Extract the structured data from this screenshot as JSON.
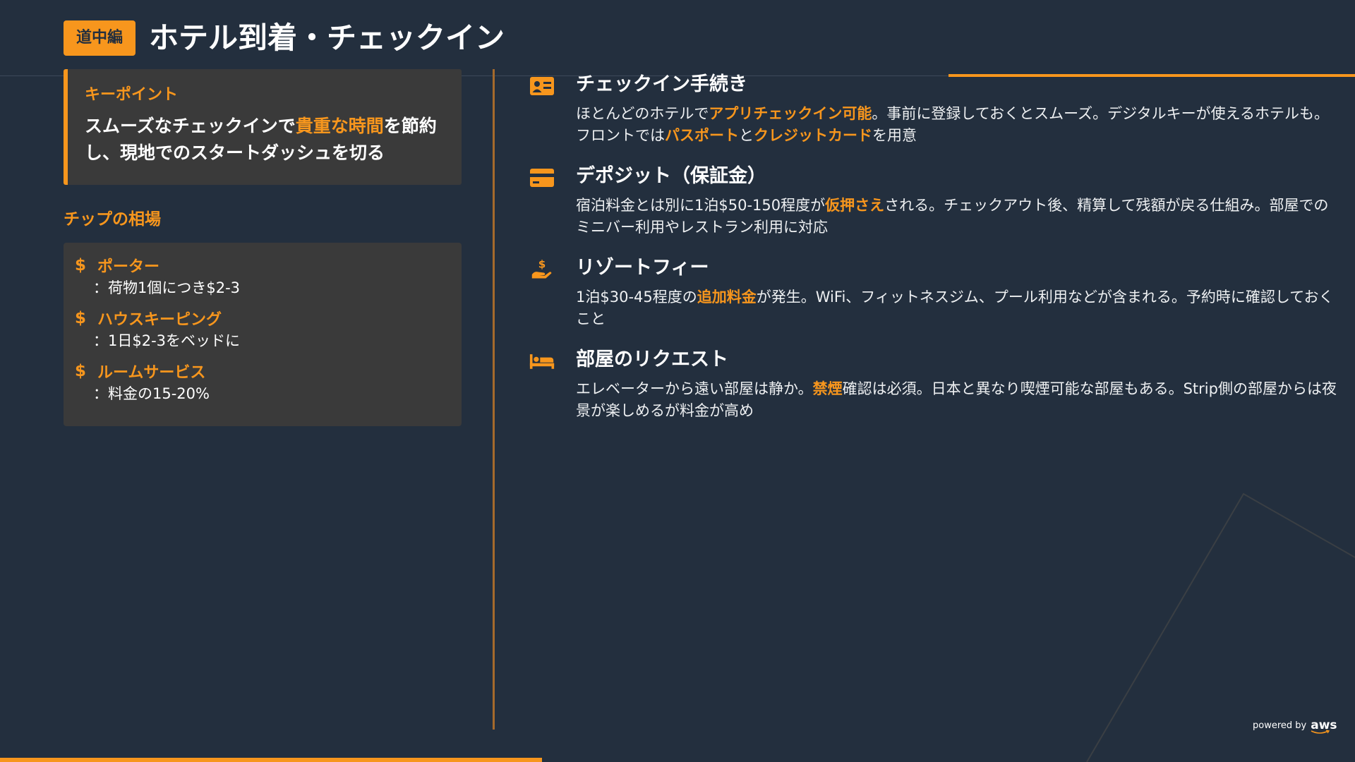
{
  "header": {
    "badge": "道中編",
    "title": "ホテル到着・チェックイン"
  },
  "keypoint": {
    "label": "キーポイント",
    "text_before": "スムーズなチェックインで",
    "highlight": "貴重な時間",
    "text_after": "を節約し、現地でのスタートダッシュを切る"
  },
  "tips": {
    "title": "チップの相場",
    "items": [
      {
        "name": "ポーター",
        "desc": "：荷物1個につき$2-3"
      },
      {
        "name": "ハウスキーピング",
        "desc": "：1日$2-3をベッドに"
      },
      {
        "name": "ルームサービス",
        "desc": "：料金の15-20%"
      }
    ]
  },
  "features": [
    {
      "icon": "id-card-icon",
      "title": "チェックイン手続き",
      "desc_parts": [
        "ほとんどのホテルで",
        "アプリチェックイン可能",
        "。事前に登録しておくとスムーズ。デジタルキーが使えるホテルも。フロントでは",
        "パスポート",
        "と",
        "クレジットカード",
        "を用意"
      ]
    },
    {
      "icon": "credit-card-icon",
      "title": "デポジット（保証金）",
      "desc_parts": [
        "宿泊料金とは別に1泊$50-150程度が",
        "仮押さえ",
        "される。チェックアウト後、精算して残額が戻る仕組み。部屋でのミニバー利用やレストラン利用に対応"
      ]
    },
    {
      "icon": "hand-dollar-icon",
      "title": "リゾートフィー",
      "desc_parts": [
        "1泊$30-45程度の",
        "追加料金",
        "が発生。WiFi、フィットネスジム、プール利用などが含まれる。予約時に確認しておくこと"
      ]
    },
    {
      "icon": "bed-icon",
      "title": "部屋のリクエスト",
      "desc_parts": [
        "エレベーターから遠い部屋は静か。",
        "禁煙",
        "確認は必須。日本と異なり喫煙可能な部屋もある。Strip側の部屋からは夜景が楽しめるが料金が高め"
      ]
    }
  ],
  "footer": {
    "powered_by": "powered by",
    "logo": "aws"
  },
  "colors": {
    "background": "#232f3e",
    "accent": "#f7961d",
    "card": "#3a3a3a"
  }
}
